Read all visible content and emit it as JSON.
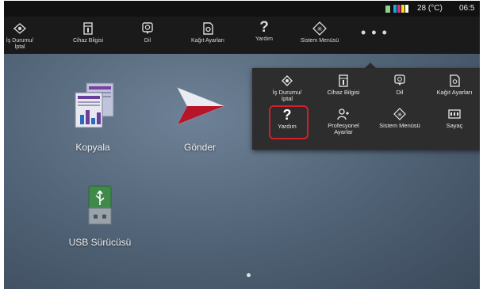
{
  "status": {
    "temperature": "28 (°C)",
    "time": "06:5"
  },
  "toolbar": {
    "items": [
      {
        "label": "İş Durumu/\nİptal",
        "icon": "job-status-icon"
      },
      {
        "label": "Cihaz Bilgisi",
        "icon": "device-info-icon"
      },
      {
        "label": "Dil",
        "icon": "language-icon"
      },
      {
        "label": "Kağıt Ayarları",
        "icon": "paper-settings-icon"
      },
      {
        "label": "Yardım",
        "icon": "help-icon"
      },
      {
        "label": "Sistem Menüsü",
        "icon": "system-menu-icon"
      }
    ],
    "more": "• • •"
  },
  "home": {
    "apps": [
      {
        "label": "Kopyala",
        "icon": "copy-icon"
      },
      {
        "label": "Gönder",
        "icon": "send-icon"
      },
      {
        "label": "USB Sürücüsü",
        "icon": "usb-drive-icon"
      }
    ]
  },
  "popup": {
    "row1": [
      {
        "label": "İş Durumu/\nİptal",
        "icon": "job-status-icon"
      },
      {
        "label": "Cihaz Bilgisi",
        "icon": "device-info-icon"
      },
      {
        "label": "Dil",
        "icon": "language-icon"
      },
      {
        "label": "Kağıt Ayarları",
        "icon": "paper-settings-icon"
      }
    ],
    "row2": [
      {
        "label": "Yardım",
        "icon": "help-icon"
      },
      {
        "label": "Profesyonel\nAyarlar",
        "icon": "professional-settings-icon"
      },
      {
        "label": "Sistem Menüsü",
        "icon": "system-menu-icon"
      },
      {
        "label": "Sayaç",
        "icon": "counter-icon"
      }
    ]
  },
  "colors": {
    "highlight": "#d1202a",
    "toolbar_bg": "#1a1a1a",
    "popup_bg": "#2d2d2d"
  }
}
